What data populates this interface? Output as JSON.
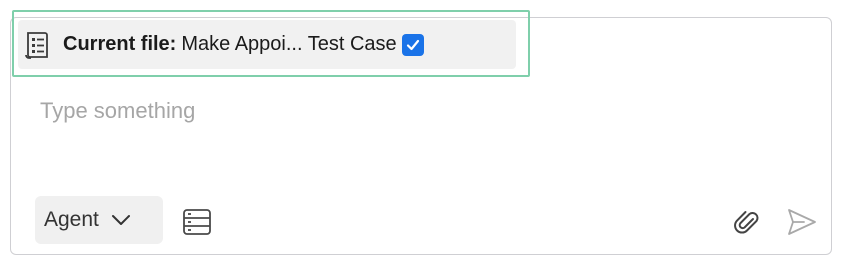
{
  "context": {
    "label": "Current file:",
    "value": "Make Appoi... Test Case",
    "checked": true,
    "icon": "test-case-icon"
  },
  "input": {
    "placeholder": "Type something",
    "value": ""
  },
  "toolbar": {
    "mode_label": "Agent",
    "mode_icon": "chevron-down-icon",
    "database_icon": "database-icon",
    "attach_icon": "paperclip-icon",
    "send_icon": "send-icon"
  },
  "colors": {
    "highlight": "#7fcfab",
    "checkbox": "#1a73e8",
    "placeholder": "#a6a6a6"
  }
}
